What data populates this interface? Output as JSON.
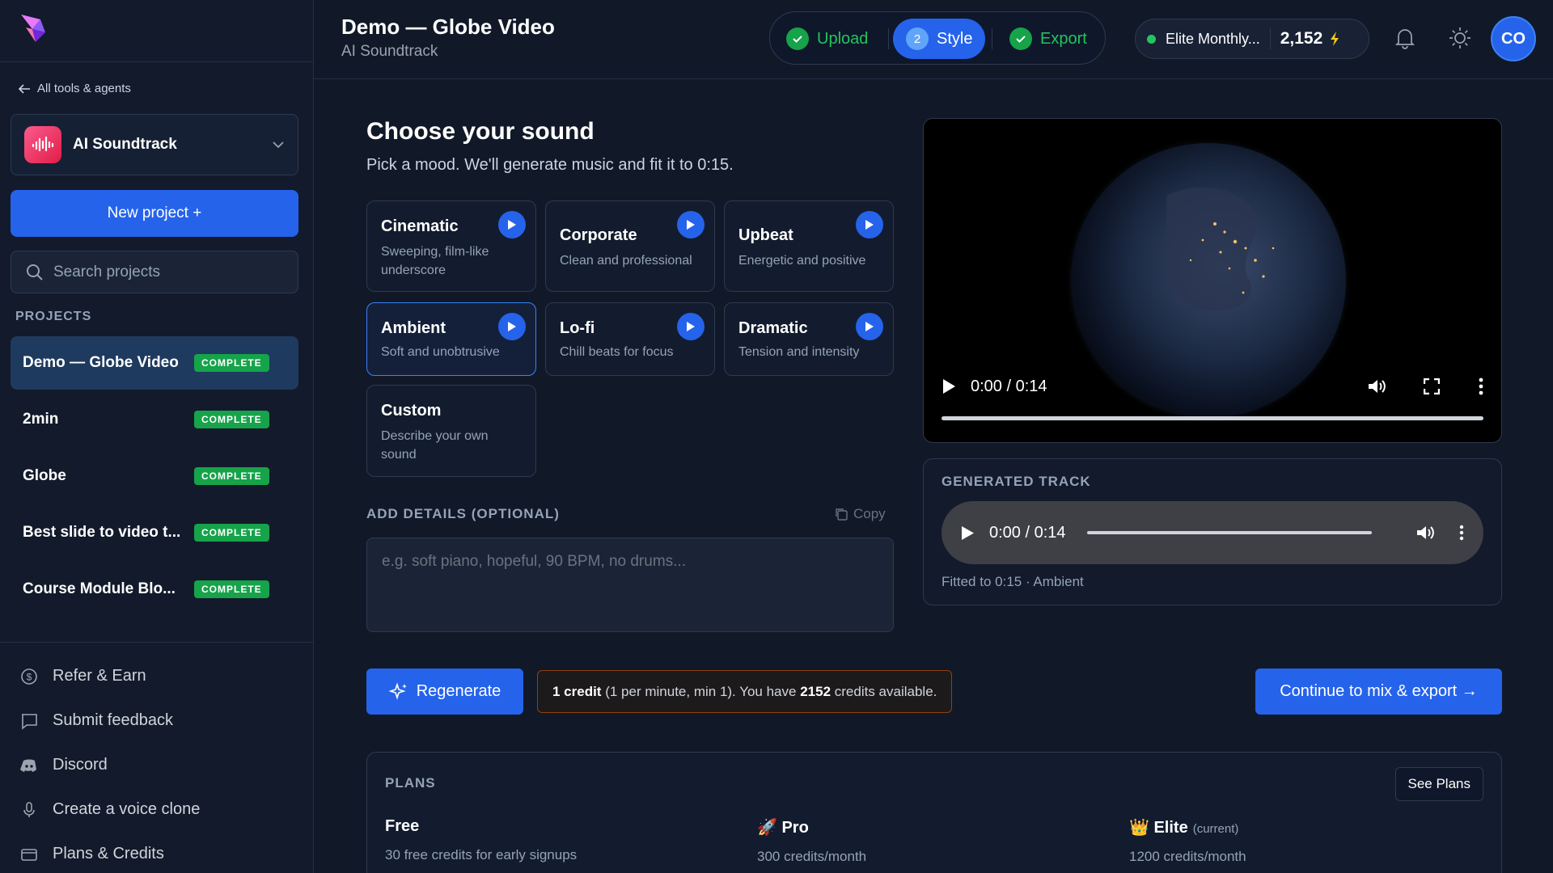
{
  "app": {
    "back_link": "All tools & agents",
    "tool_name": "AI Soundtrack",
    "new_project": "New project +",
    "search_placeholder": "Search projects"
  },
  "sidebar": {
    "projects_heading": "PROJECTS",
    "projects": [
      {
        "name": "Demo — Globe Video",
        "status": "COMPLETE",
        "active": true
      },
      {
        "name": "2min",
        "status": "COMPLETE"
      },
      {
        "name": "Globe",
        "status": "COMPLETE"
      },
      {
        "name": "Best slide to video t...",
        "status": "COMPLETE"
      },
      {
        "name": "Course Module Blo...",
        "status": "COMPLETE"
      }
    ],
    "links": [
      {
        "label": "Refer & Earn",
        "icon": "dollar-icon"
      },
      {
        "label": "Submit feedback",
        "icon": "chat-icon"
      },
      {
        "label": "Discord",
        "icon": "discord-icon"
      },
      {
        "label": "Create a voice clone",
        "icon": "microphone-icon"
      },
      {
        "label": "Plans & Credits",
        "icon": "credit-card-icon"
      }
    ]
  },
  "header": {
    "title": "Demo — Globe Video",
    "subtitle": "AI Soundtrack",
    "steps": [
      {
        "label": "Upload",
        "state": "done"
      },
      {
        "label": "Style",
        "state": "current",
        "number": "2"
      },
      {
        "label": "Export",
        "state": "done"
      }
    ],
    "plan_name": "Elite Monthly...",
    "credits": "2,152",
    "avatar_initials": "CO"
  },
  "main": {
    "heading": "Choose your sound",
    "lead": "Pick a mood. We'll generate music and fit it to 0:15.",
    "moods": [
      {
        "title": "Cinematic",
        "desc": "Sweeping, film-like underscore"
      },
      {
        "title": "Corporate",
        "desc": "Clean and professional"
      },
      {
        "title": "Upbeat",
        "desc": "Energetic and positive"
      },
      {
        "title": "Ambient",
        "desc": "Soft and unobtrusive",
        "selected": true
      },
      {
        "title": "Lo-fi",
        "desc": "Chill beats for focus"
      },
      {
        "title": "Dramatic",
        "desc": "Tension and intensity"
      },
      {
        "title": "Custom",
        "desc": "Describe your own sound"
      }
    ],
    "details_heading": "ADD DETAILS (OPTIONAL)",
    "copy_label": "Copy",
    "details_placeholder": "e.g. soft piano, hopeful, 90 BPM, no drums...",
    "regenerate": "Regenerate",
    "credit_note": {
      "amount": "1 credit",
      "rule": "(1 per minute, min 1). You have",
      "available": "2152",
      "suffix": "credits available."
    },
    "continue": "Continue to mix & export →"
  },
  "video": {
    "time": "0:00 / 0:14"
  },
  "generated": {
    "heading": "GENERATED TRACK",
    "time": "0:00 / 0:14",
    "fit_note": "Fitted to 0:15 · Ambient"
  },
  "plans": {
    "heading": "PLANS",
    "see_plans": "See Plans",
    "items": [
      {
        "name": "Free",
        "credits": "30 free credits for early signups"
      },
      {
        "name": "Pro",
        "emoji": "🚀",
        "credits": "300 credits/month"
      },
      {
        "name": "Elite",
        "emoji": "👑",
        "tag": "(current)",
        "credits": "1200 credits/month"
      }
    ]
  },
  "colors": {
    "accent": "#2563eb",
    "success": "#16a34a",
    "background": "#111827"
  }
}
